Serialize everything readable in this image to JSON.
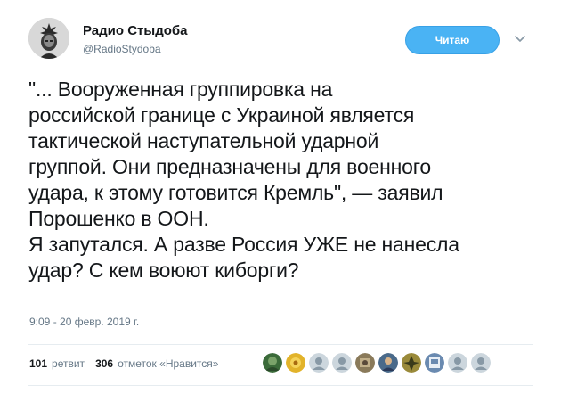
{
  "author": {
    "name": "Радио Стыдоба",
    "handle": "@RadioStydoba"
  },
  "follow_button": {
    "label": "Читаю"
  },
  "menu": {
    "icon": "chevron-down-icon"
  },
  "tweet": {
    "lines": [
      "\"... Вооруженная группировка на",
      "российской границе с Украиной является",
      "тактической наступательной ударной",
      "группой. Они предназначены для военного",
      "удара, к этому готовится Кремль\", — заявил",
      "Порошенко в ООН.",
      "Я запутался. А разве Россия УЖЕ не нанесла",
      "удар? С кем воюют киборги?"
    ],
    "timestamp": "9:09 - 20 февр. 2019 г."
  },
  "stats": {
    "retweets_count": "101",
    "retweets_label": "ретвит",
    "likes_count": "306",
    "likes_label": "отметок «Нравится»"
  },
  "colors": {
    "accent": "#4ab3f4",
    "text": "#14171a",
    "muted": "#657786",
    "divider": "#e6ecf0"
  },
  "liker_avatars": [
    {
      "icon": "avatar-icon",
      "color": "#3b6b3a"
    },
    {
      "icon": "avatar-icon",
      "color": "#e2b32a"
    },
    {
      "icon": "default-avatar-icon",
      "color": "#b8c3cc"
    },
    {
      "icon": "default-avatar-icon",
      "color": "#b8c3cc"
    },
    {
      "icon": "avatar-icon",
      "color": "#8a7a5a"
    },
    {
      "icon": "avatar-icon",
      "color": "#4a6a8a"
    },
    {
      "icon": "avatar-icon",
      "color": "#9a8a3a"
    },
    {
      "icon": "avatar-icon",
      "color": "#6a8ab0"
    },
    {
      "icon": "default-avatar-icon",
      "color": "#b8c3cc"
    },
    {
      "icon": "default-avatar-icon",
      "color": "#b8c3cc"
    }
  ]
}
